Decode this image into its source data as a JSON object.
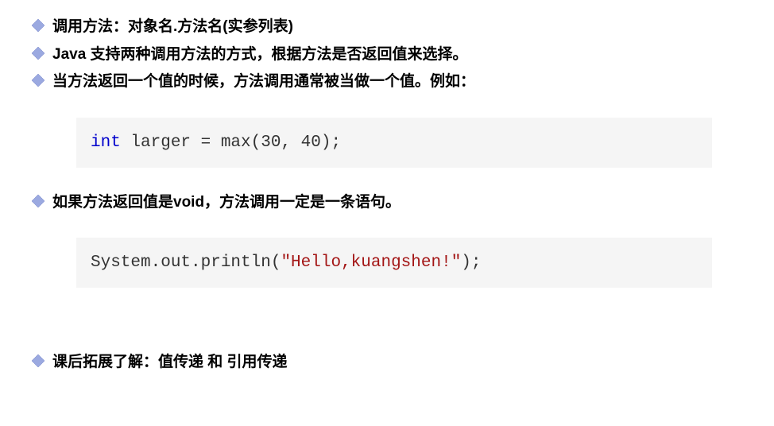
{
  "bullets": {
    "b1": "调用方法：对象名.方法名(实参列表)",
    "b2": "Java 支持两种调用方法的方式，根据方法是否返回值来选择。",
    "b3": "当方法返回一个值的时候，方法调用通常被当做一个值。例如：",
    "b4": "如果方法返回值是void，方法调用一定是一条语句。",
    "b5": "课后拓展了解：值传递 和 引用传递"
  },
  "code1": {
    "keyword": "int",
    "rest": " larger = max(30, 40);"
  },
  "code2": {
    "prefix": "System.out.println(",
    "string": "\"Hello,kuangshen!\"",
    "suffix": ");"
  }
}
